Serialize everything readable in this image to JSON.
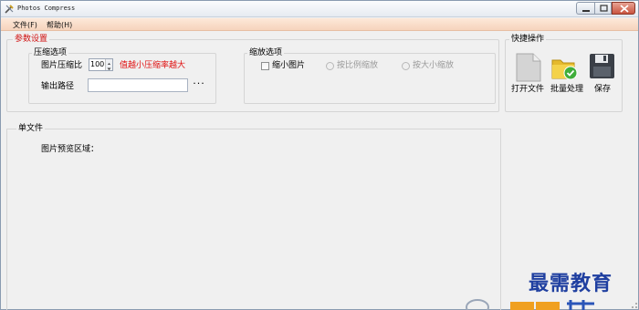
{
  "window": {
    "title": "Photos Compress"
  },
  "menu": {
    "items": [
      {
        "label": "文件(F)"
      },
      {
        "label": "帮助(H)"
      }
    ]
  },
  "params_group": {
    "title": "参数设置",
    "compress": {
      "title": "压缩选项",
      "ratio_label": "图片压缩比",
      "ratio_value": "100",
      "hint": "值越小压缩率越大",
      "output_label": "输出路径",
      "output_value": "",
      "browse_label": "···"
    },
    "scale": {
      "title": "缩放选项",
      "shrink_label": "缩小图片",
      "shrink_checked": false,
      "by_ratio_label": "按比例缩放",
      "by_size_label": "按大小缩放"
    }
  },
  "quick_actions": {
    "title": "快捷操作",
    "open_label": "打开文件",
    "batch_label": "批量处理",
    "save_label": "保存"
  },
  "single_file": {
    "title": "单文件",
    "preview_label": "图片预览区域："
  },
  "watermark": {
    "text": "最需教育"
  },
  "colors": {
    "menubar": "#f6d3bc",
    "accent_red": "#e01010",
    "watermark_blue": "#1f3fa0"
  }
}
